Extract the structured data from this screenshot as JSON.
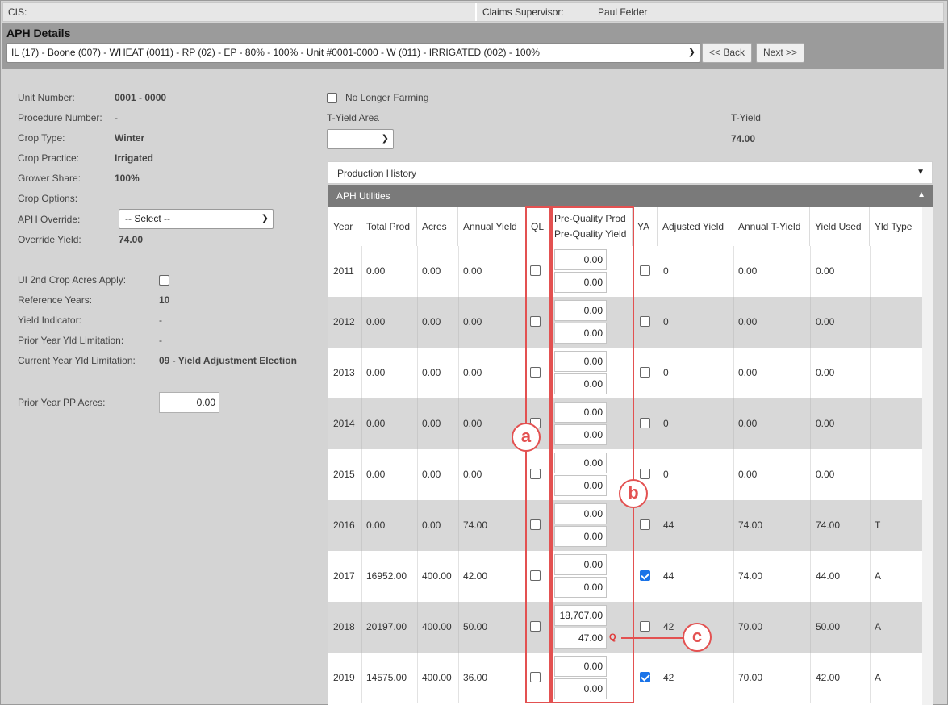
{
  "header": {
    "cis_label": "CIS:",
    "claims_supervisor_label": "Claims Supervisor:",
    "claims_supervisor_name": "Paul Felder"
  },
  "aph": {
    "title": "APH Details",
    "unit_selector": "IL (17) - Boone (007) - WHEAT (0011) - RP (02) - EP - 80% - 100% - Unit #0001-0000 - W (011) - IRRIGATED (002) - 100%",
    "back_label": "<< Back",
    "next_label": "Next >>"
  },
  "info": {
    "unit_number_label": "Unit Number:",
    "unit_number": "0001 - 0000",
    "procedure_number_label": "Procedure Number:",
    "procedure_number": "-",
    "crop_type_label": "Crop Type:",
    "crop_type": "Winter",
    "crop_practice_label": "Crop Practice:",
    "crop_practice": "Irrigated",
    "grower_share_label": "Grower Share:",
    "grower_share": "100%",
    "crop_options_label": "Crop Options:",
    "aph_override_label": "APH Override:",
    "aph_override_value": "-- Select --",
    "override_yield_label": "Override Yield:",
    "override_yield": "74.00",
    "ui_2nd_crop_label": "UI 2nd Crop Acres Apply:",
    "reference_years_label": "Reference Years:",
    "reference_years": "10",
    "yield_indicator_label": "Yield Indicator:",
    "yield_indicator": "-",
    "prior_year_limit_label": "Prior Year Yld Limitation:",
    "prior_year_limit": "-",
    "current_year_limit_label": "Current Year Yld Limitation:",
    "current_year_limit": "09 - Yield Adjustment Election",
    "prior_pp_acres_label": "Prior Year PP Acres:",
    "prior_pp_acres": "0.00"
  },
  "right": {
    "no_longer_farming_label": "No Longer Farming",
    "t_yield_area_label": "T-Yield Area",
    "t_yield_label": "T-Yield",
    "t_yield_value": "74.00",
    "production_history_label": "Production History",
    "aph_utilities_label": "APH Utilities"
  },
  "table": {
    "headers": {
      "year": "Year",
      "total_prod": "Total Prod",
      "acres": "Acres",
      "annual_yield": "Annual Yield",
      "ql": "QL",
      "pq_prod": "Pre-Quality Prod",
      "pq_yield": "Pre-Quality Yield",
      "ya": "YA",
      "adjusted_yield": "Adjusted Yield",
      "annual_t_yield": "Annual T-Yield",
      "yield_used": "Yield Used",
      "yld_type": "Yld Type"
    },
    "rows": [
      {
        "year": "2011",
        "total_prod": "0.00",
        "acres": "0.00",
        "annual_yield": "0.00",
        "ql": false,
        "pq_prod": "0.00",
        "pq_yield": "0.00",
        "q_flag": "",
        "ya": false,
        "adjusted_yield": "0",
        "annual_t_yield": "0.00",
        "yield_used": "0.00",
        "yld_type": ""
      },
      {
        "year": "2012",
        "total_prod": "0.00",
        "acres": "0.00",
        "annual_yield": "0.00",
        "ql": false,
        "pq_prod": "0.00",
        "pq_yield": "0.00",
        "q_flag": "",
        "ya": false,
        "adjusted_yield": "0",
        "annual_t_yield": "0.00",
        "yield_used": "0.00",
        "yld_type": ""
      },
      {
        "year": "2013",
        "total_prod": "0.00",
        "acres": "0.00",
        "annual_yield": "0.00",
        "ql": false,
        "pq_prod": "0.00",
        "pq_yield": "0.00",
        "q_flag": "",
        "ya": false,
        "adjusted_yield": "0",
        "annual_t_yield": "0.00",
        "yield_used": "0.00",
        "yld_type": ""
      },
      {
        "year": "2014",
        "total_prod": "0.00",
        "acres": "0.00",
        "annual_yield": "0.00",
        "ql": false,
        "pq_prod": "0.00",
        "pq_yield": "0.00",
        "q_flag": "",
        "ya": false,
        "adjusted_yield": "0",
        "annual_t_yield": "0.00",
        "yield_used": "0.00",
        "yld_type": ""
      },
      {
        "year": "2015",
        "total_prod": "0.00",
        "acres": "0.00",
        "annual_yield": "0.00",
        "ql": false,
        "pq_prod": "0.00",
        "pq_yield": "0.00",
        "q_flag": "",
        "ya": false,
        "adjusted_yield": "0",
        "annual_t_yield": "0.00",
        "yield_used": "0.00",
        "yld_type": ""
      },
      {
        "year": "2016",
        "total_prod": "0.00",
        "acres": "0.00",
        "annual_yield": "74.00",
        "ql": false,
        "pq_prod": "0.00",
        "pq_yield": "0.00",
        "q_flag": "",
        "ya": false,
        "adjusted_yield": "44",
        "annual_t_yield": "74.00",
        "yield_used": "74.00",
        "yld_type": "T"
      },
      {
        "year": "2017",
        "total_prod": "16952.00",
        "acres": "400.00",
        "annual_yield": "42.00",
        "ql": false,
        "pq_prod": "0.00",
        "pq_yield": "0.00",
        "q_flag": "",
        "ya": true,
        "adjusted_yield": "44",
        "annual_t_yield": "74.00",
        "yield_used": "44.00",
        "yld_type": "A"
      },
      {
        "year": "2018",
        "total_prod": "20197.00",
        "acres": "400.00",
        "annual_yield": "50.00",
        "ql": false,
        "pq_prod": "18,707.00",
        "pq_yield": "47.00",
        "q_flag": "Q",
        "ya": false,
        "adjusted_yield": "42",
        "annual_t_yield": "70.00",
        "yield_used": "50.00",
        "yld_type": "A"
      },
      {
        "year": "2019",
        "total_prod": "14575.00",
        "acres": "400.00",
        "annual_yield": "36.00",
        "ql": false,
        "pq_prod": "0.00",
        "pq_yield": "0.00",
        "q_flag": "",
        "ya": true,
        "adjusted_yield": "42",
        "annual_t_yield": "70.00",
        "yield_used": "42.00",
        "yld_type": "A"
      }
    ]
  },
  "annotations": {
    "a": "a",
    "b": "b",
    "c": "c"
  },
  "colors": {
    "annotation": "#e35151",
    "checkbox_checked": "#1a73e8",
    "q_flag": "#e03a3a"
  }
}
